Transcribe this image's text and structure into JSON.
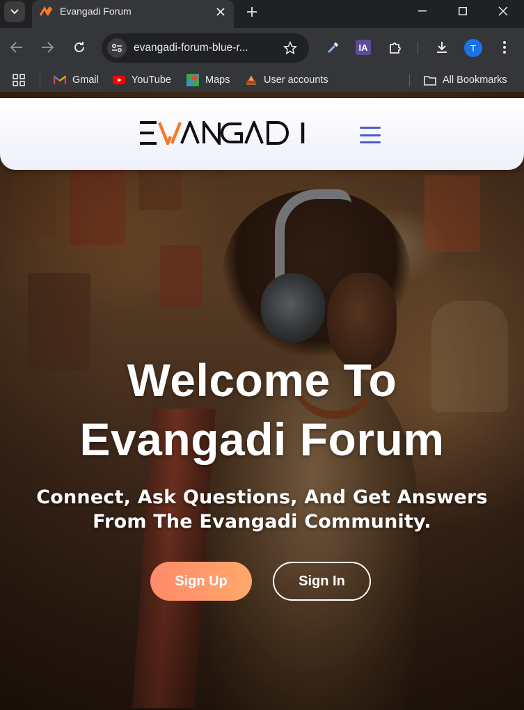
{
  "browser": {
    "tab": {
      "title": "Evangadi Forum"
    },
    "address_bar": {
      "url": "evangadi-forum-blue-r..."
    },
    "extension_badge": "IA",
    "profile_initial": "T",
    "bookmarks": [
      {
        "label": "Gmail"
      },
      {
        "label": "YouTube"
      },
      {
        "label": "Maps"
      },
      {
        "label": "User accounts"
      }
    ],
    "all_bookmarks_label": "All Bookmarks"
  },
  "site": {
    "logo_text": "EVANGADI",
    "hero": {
      "title": "Welcome To Evangadi Forum",
      "subtitle": "Connect, Ask Questions, And Get Answers From The Evangadi Community."
    },
    "buttons": {
      "sign_up": "Sign Up",
      "sign_in": "Sign In"
    }
  },
  "colors": {
    "accent_orange": "#ff8a6a",
    "hamburger_blue": "#4a5bd8",
    "browser_bg": "#35363a"
  }
}
